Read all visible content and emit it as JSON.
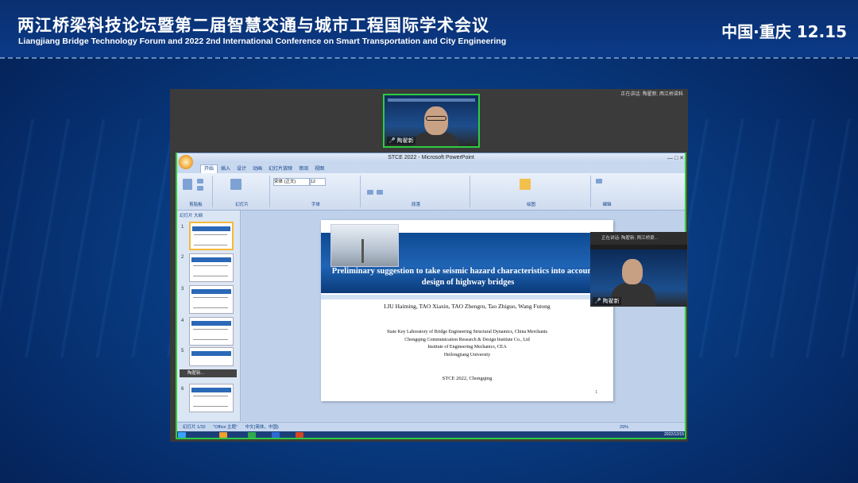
{
  "banner": {
    "title_cn": "两江桥梁科技论坛暨第二届智慧交通与城市工程国际学术会议",
    "title_en": "Liangjiang Bridge Technology Forum and 2022 2nd International Conference on Smart Transportation and City Engineering",
    "location_date": "中国·重庆  12.15"
  },
  "zoom": {
    "top_status": "正在讲话: 陶翟新; 两江桥梁科",
    "speaker_name": "陶翟新",
    "cam2_status": "正在讲话: 陶翟新; 两江桥梁...",
    "cam2_name": "陶翟新"
  },
  "ppt": {
    "window_title": "STCE 2022 - Microsoft PowerPoint",
    "window_buttons": "— □ ✕",
    "tabs": [
      "开始",
      "插入",
      "设计",
      "动画",
      "幻灯片放映",
      "审阅",
      "视图"
    ],
    "ribbon_groups": [
      "剪贴板",
      "幻灯片",
      "字体",
      "段落",
      "绘图",
      "编辑"
    ],
    "font_name": "宋体 (正文)",
    "font_size": "12",
    "pane_tabs": "幻灯片  大纲",
    "thumb_numbers": [
      "1",
      "2",
      "3",
      "4",
      "5",
      "6"
    ],
    "tooltip": "陶翟新...",
    "status_slide": "幻灯片 1/32",
    "status_theme": "\"Office 主题\"",
    "status_lang": "中文(简体，中国)",
    "zoom_percent": "29%",
    "tray_date": "2022/12/15"
  },
  "slide": {
    "title": "Preliminary suggestion to take seismic hazard characteristics into account in design of highway bridges",
    "authors": "LIU Haiming,  TAO Xiaxin,  TAO Zhengru,  Tao Zhiguo,  Wang Futong",
    "aff1": "State Key Laboratory of Bridge Engineering Structural Dynamics, China Merchants",
    "aff2": "Chongqing Communication Research & Design Institute Co., Ltd",
    "aff3": "Institute of Engineering Mechanics, CEA",
    "aff4": "Heilongjiang University",
    "conference": "STCE 2022, Chongqing",
    "page": "1"
  }
}
